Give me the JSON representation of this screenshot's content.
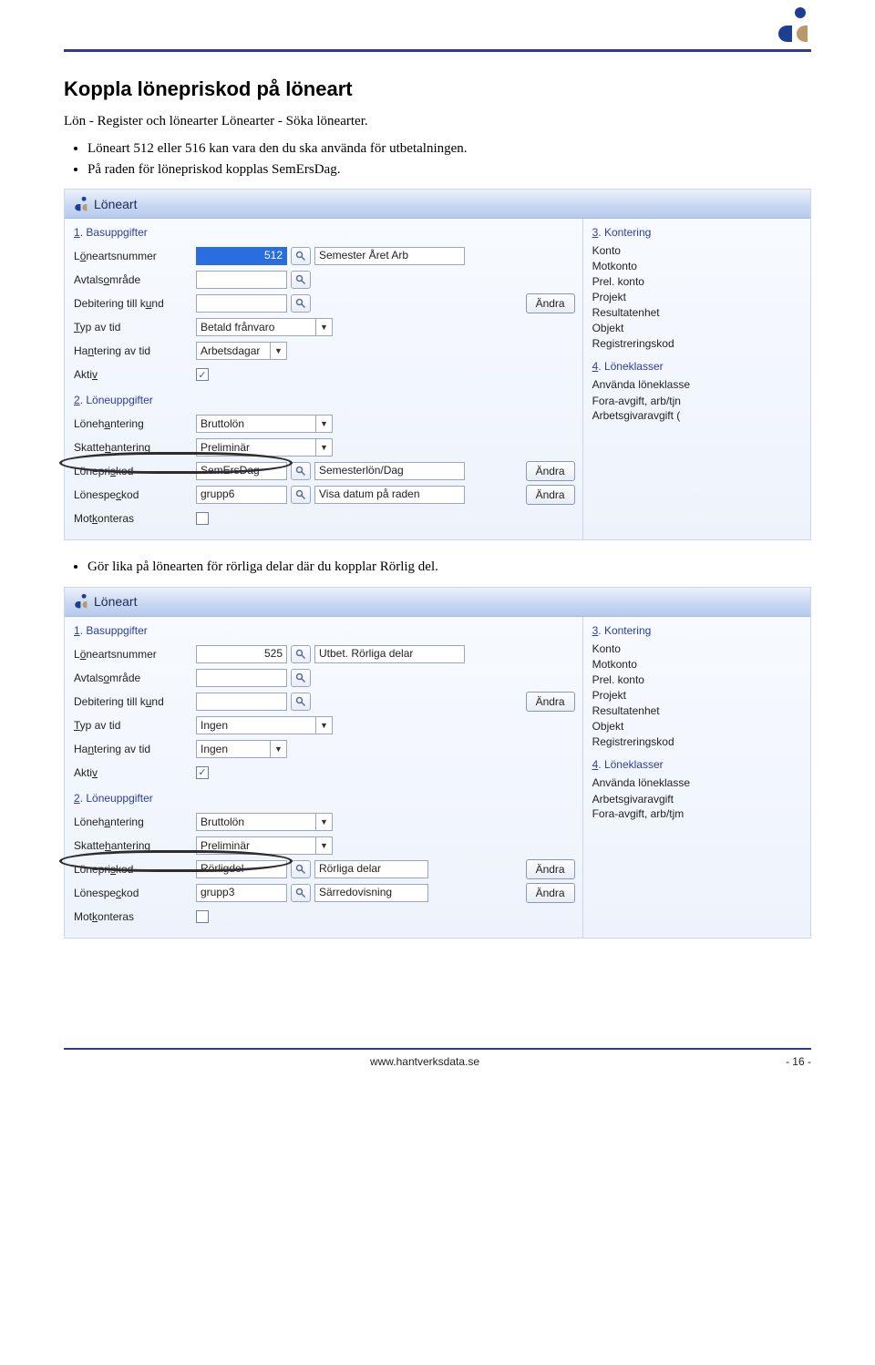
{
  "doc": {
    "heading": "Koppla lönepriskod på löneart",
    "lead": "Lön - Register och lönearter Lönearter - Söka lönearter.",
    "bullets_a": [
      "Löneart 512 eller 516 kan vara den du ska använda för utbetalningen.",
      "På raden för lönepriskod kopplas SemErsDag."
    ],
    "bullets_b": [
      "Gör lika på lönearten för rörliga delar där du kopplar Rörlig del."
    ],
    "footer_url": "www.hantverksdata.se",
    "page_no": "- 16 -"
  },
  "window_title": "Löneart",
  "section1_title_html": {
    "pre": "1",
    "rest": ". Basuppgifter"
  },
  "section2_title_html": {
    "pre": "2",
    "rest": ". Löneuppgifter"
  },
  "section3_title_html": {
    "pre": "3",
    "rest": ". Kontering"
  },
  "section4_title_html": {
    "pre": "4",
    "rest": ". Löneklasser"
  },
  "labels": {
    "loneartsnummer": "Löneartsnummer",
    "avtalsomrade": "Avtalsområde",
    "debitering": "Debitering till kund",
    "typ_av_tid": "Typ av tid",
    "hantering": "Hantering av tid",
    "aktiv": "Aktiv",
    "lonehantering": "Lönehantering",
    "skattehantering": "Skattehantering",
    "lonepriskod": "Lönepriskod",
    "lonespeckod": "Lönespeckod",
    "motkonteras": "Motkonteras"
  },
  "right_labels": {
    "konto": "Konto",
    "motkonto": "Motkonto",
    "prel_konto": "Prel. konto",
    "projekt": "Projekt",
    "resultatenhet": "Resultatenhet",
    "objekt": "Objekt",
    "registreringskod": "Registreringskod",
    "anvanda_loneklasse": "Använda löneklasse"
  },
  "buttons": {
    "andra": "Ändra"
  },
  "panel1": {
    "loneartsnummer": "512",
    "loneart_namn": "Semester Året Arb",
    "typ_av_tid": "Betald frånvaro",
    "hantering": "Arbetsdagar",
    "aktiv_checked": "✓",
    "lonehantering": "Bruttolön",
    "skattehantering": "Preliminär",
    "lonepriskod": "SemErsDag",
    "lonepriskod_desc": "Semesterlön/Dag",
    "lonespeckod": "grupp6",
    "lonespeckod_desc": "Visa datum på raden",
    "loneklasser": [
      "Fora-avgift, arb/tjn",
      "Arbetsgivaravgift ("
    ]
  },
  "panel2": {
    "loneartsnummer": "525",
    "loneart_namn": "Utbet. Rörliga delar",
    "typ_av_tid": "Ingen",
    "hantering": "Ingen",
    "aktiv_checked": "✓",
    "lonehantering": "Bruttolön",
    "skattehantering": "Preliminär",
    "lonepriskod": "Rörligdel",
    "lonepriskod_desc": "Rörliga delar",
    "lonespeckod": "grupp3",
    "lonespeckod_desc": "Särredovisning",
    "loneklasser": [
      "Arbetsgivaravgift",
      "Fora-avgift, arb/tjm"
    ]
  }
}
